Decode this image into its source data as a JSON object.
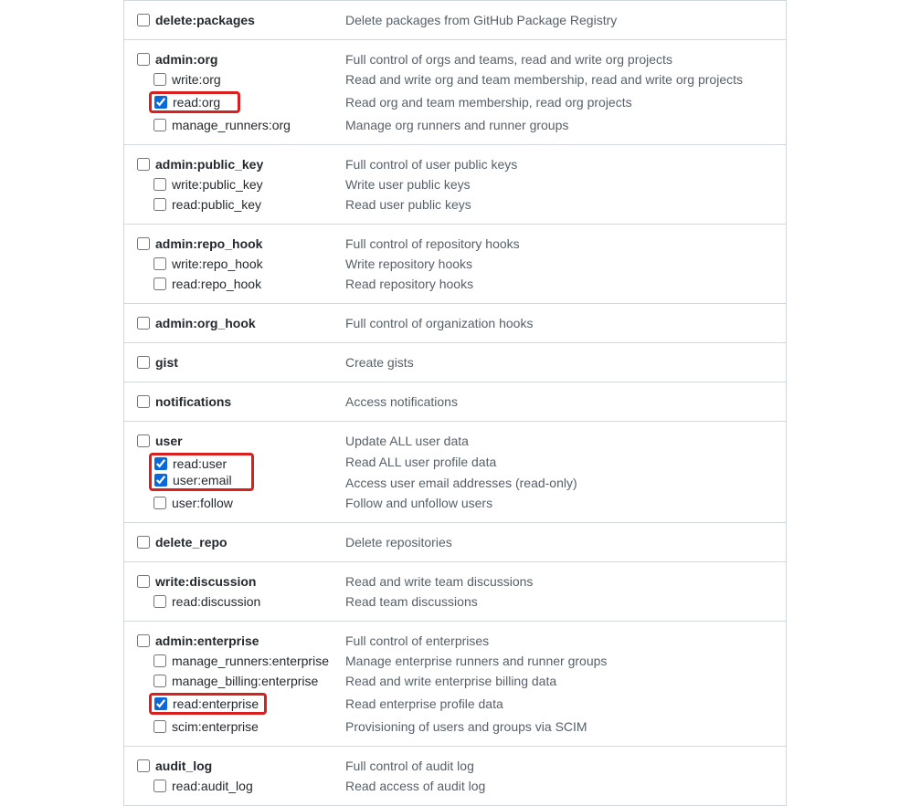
{
  "groups": [
    {
      "parent": {
        "label": "delete:packages",
        "desc": "Delete packages from GitHub Package Registry",
        "checked": false
      },
      "children": []
    },
    {
      "parent": {
        "label": "admin:org",
        "desc": "Full control of orgs and teams, read and write org projects",
        "checked": false
      },
      "children": [
        {
          "label": "write:org",
          "desc": "Read and write org and team membership, read and write org projects",
          "checked": false,
          "highlight": false
        },
        {
          "label": "read:org",
          "desc": "Read org and team membership, read org projects",
          "checked": true,
          "highlight": true
        },
        {
          "label": "manage_runners:org",
          "desc": "Manage org runners and runner groups",
          "checked": false,
          "highlight": false
        }
      ]
    },
    {
      "parent": {
        "label": "admin:public_key",
        "desc": "Full control of user public keys",
        "checked": false
      },
      "children": [
        {
          "label": "write:public_key",
          "desc": "Write user public keys",
          "checked": false
        },
        {
          "label": "read:public_key",
          "desc": "Read user public keys",
          "checked": false
        }
      ]
    },
    {
      "parent": {
        "label": "admin:repo_hook",
        "desc": "Full control of repository hooks",
        "checked": false
      },
      "children": [
        {
          "label": "write:repo_hook",
          "desc": "Write repository hooks",
          "checked": false
        },
        {
          "label": "read:repo_hook",
          "desc": "Read repository hooks",
          "checked": false
        }
      ]
    },
    {
      "parent": {
        "label": "admin:org_hook",
        "desc": "Full control of organization hooks",
        "checked": false
      },
      "children": []
    },
    {
      "parent": {
        "label": "gist",
        "desc": "Create gists",
        "checked": false
      },
      "children": []
    },
    {
      "parent": {
        "label": "notifications",
        "desc": "Access notifications",
        "checked": false
      },
      "children": []
    },
    {
      "parent": {
        "label": "user",
        "desc": "Update ALL user data",
        "checked": false
      },
      "children": [
        {
          "label": "read:user",
          "desc": "Read ALL user profile data",
          "checked": true,
          "highlight": true,
          "groupHighlight": "start"
        },
        {
          "label": "user:email",
          "desc": "Access user email addresses (read-only)",
          "checked": true,
          "highlight": true,
          "groupHighlight": "end"
        },
        {
          "label": "user:follow",
          "desc": "Follow and unfollow users",
          "checked": false
        }
      ]
    },
    {
      "parent": {
        "label": "delete_repo",
        "desc": "Delete repositories",
        "checked": false
      },
      "children": []
    },
    {
      "parent": {
        "label": "write:discussion",
        "desc": "Read and write team discussions",
        "checked": false
      },
      "children": [
        {
          "label": "read:discussion",
          "desc": "Read team discussions",
          "checked": false
        }
      ]
    },
    {
      "parent": {
        "label": "admin:enterprise",
        "desc": "Full control of enterprises",
        "checked": false
      },
      "children": [
        {
          "label": "manage_runners:enterprise",
          "desc": "Manage enterprise runners and runner groups",
          "checked": false
        },
        {
          "label": "manage_billing:enterprise",
          "desc": "Read and write enterprise billing data",
          "checked": false
        },
        {
          "label": "read:enterprise",
          "desc": "Read enterprise profile data",
          "checked": true,
          "highlight": true
        },
        {
          "label": "scim:enterprise",
          "desc": "Provisioning of users and groups via SCIM",
          "checked": false
        }
      ]
    },
    {
      "parent": {
        "label": "audit_log",
        "desc": "Full control of audit log",
        "checked": false
      },
      "children": [
        {
          "label": "read:audit_log",
          "desc": "Read access of audit log",
          "checked": false
        }
      ]
    }
  ]
}
